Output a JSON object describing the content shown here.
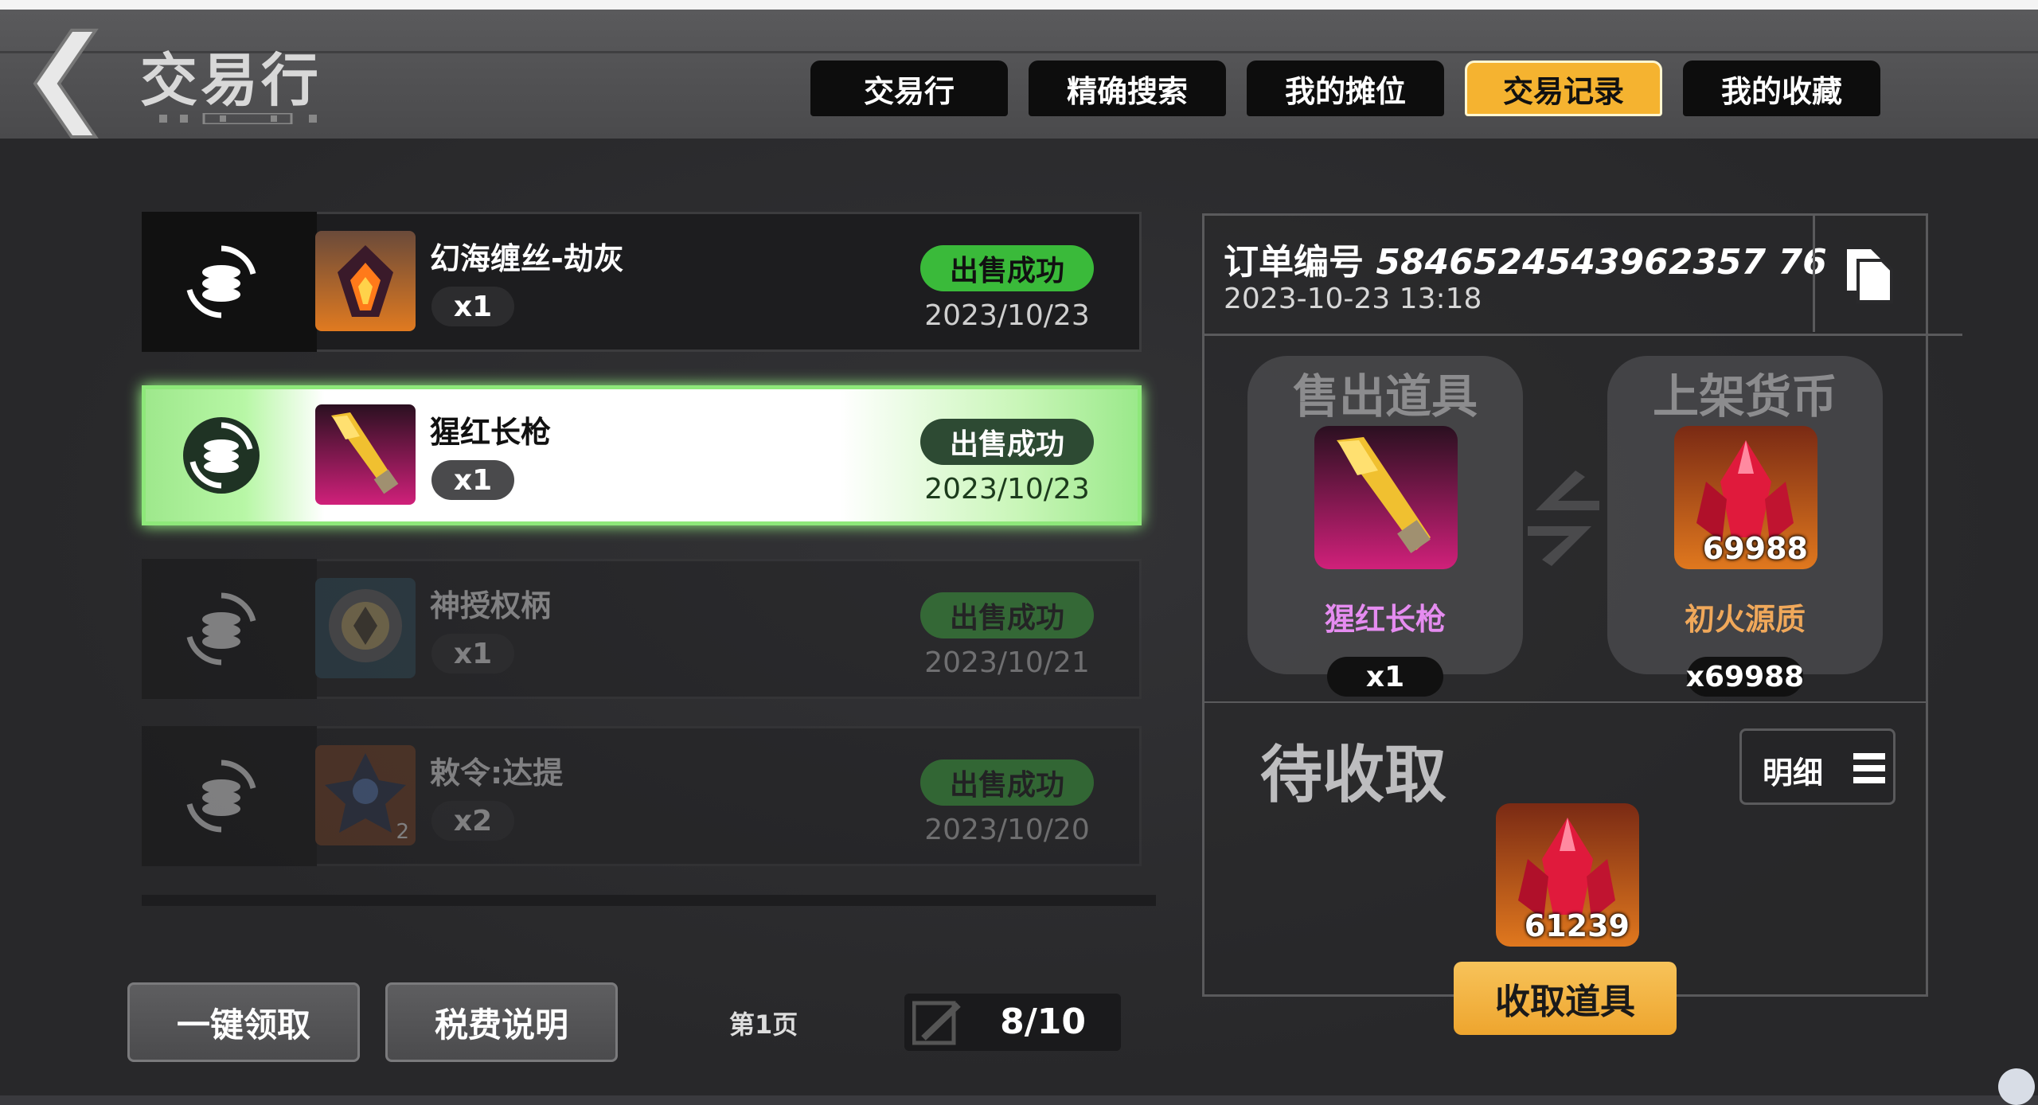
{
  "header": {
    "title": "交易行",
    "tabs": [
      {
        "label": "交易行",
        "active": false
      },
      {
        "label": "精确搜索",
        "active": false
      },
      {
        "label": "我的摊位",
        "active": false
      },
      {
        "label": "交易记录",
        "active": true
      },
      {
        "label": "我的收藏",
        "active": false
      }
    ]
  },
  "records": [
    {
      "name": "幻海缠丝-劫灰",
      "qty": "x1",
      "status": "出售成功",
      "date": "2023/10/23",
      "selected": false,
      "dimmed": false,
      "thumb": "dark-flame-gem-icon"
    },
    {
      "name": "猩红长枪",
      "qty": "x1",
      "status": "出售成功",
      "date": "2023/10/23",
      "selected": true,
      "dimmed": false,
      "thumb": "crimson-lance-icon"
    },
    {
      "name": "神授权柄",
      "qty": "x1",
      "status": "出售成功",
      "date": "2023/10/21",
      "selected": false,
      "dimmed": true,
      "thumb": "divine-scepter-icon"
    },
    {
      "name": "敕令:达提",
      "qty": "x2",
      "status": "出售成功",
      "date": "2023/10/20",
      "selected": false,
      "dimmed": true,
      "thumb": "edict-datti-icon",
      "thumb_badge": "2"
    }
  ],
  "bottom": {
    "claim_all": "一键领取",
    "tax_info": "税费说明",
    "page_label": "第1页",
    "page_count": "8/10"
  },
  "detail": {
    "order_label": "订单编号",
    "order_no": "5846524543962357 76",
    "order_time": "2023-10-23 13:18",
    "sold_title": "售出道具",
    "sold_name": "猩红长枪",
    "sold_qty": "x1",
    "price_title": "上架货币",
    "price_name": "初火源质",
    "price_amount_badge": "69988",
    "price_qty": "x69988",
    "pending_title": "待收取",
    "detail_btn": "明细",
    "pending_amount": "61239",
    "claim_btn": "收取道具",
    "colors": {
      "sold_name": "#e58cf0",
      "price_name": "#f0a85a",
      "accent": "#f5b330",
      "success": "#3aba3a"
    }
  }
}
